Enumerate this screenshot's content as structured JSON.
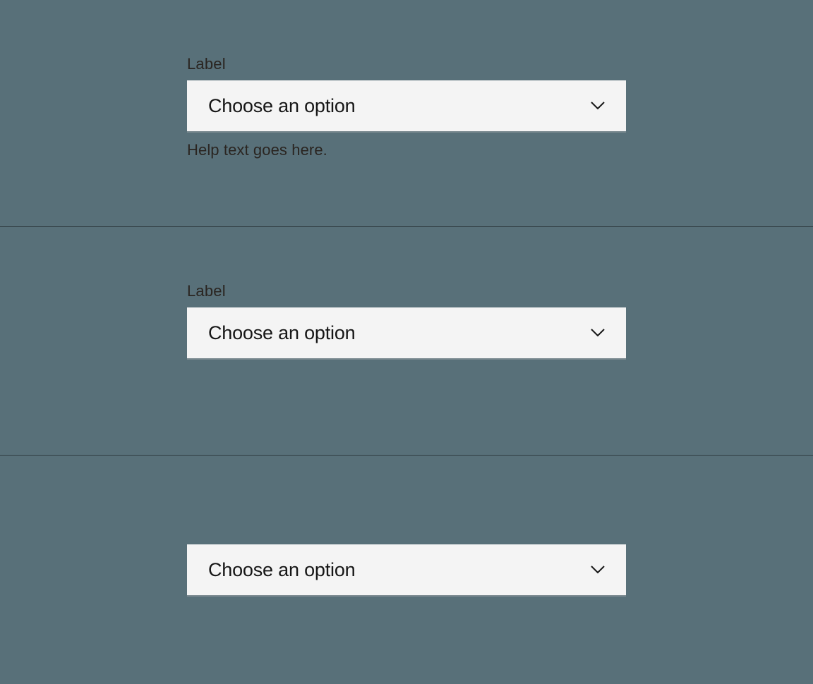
{
  "fields": [
    {
      "label": "Label",
      "placeholder": "Choose an option",
      "help": "Help text goes here."
    },
    {
      "label": "Label",
      "placeholder": "Choose an option"
    },
    {
      "placeholder": "Choose an option"
    }
  ]
}
